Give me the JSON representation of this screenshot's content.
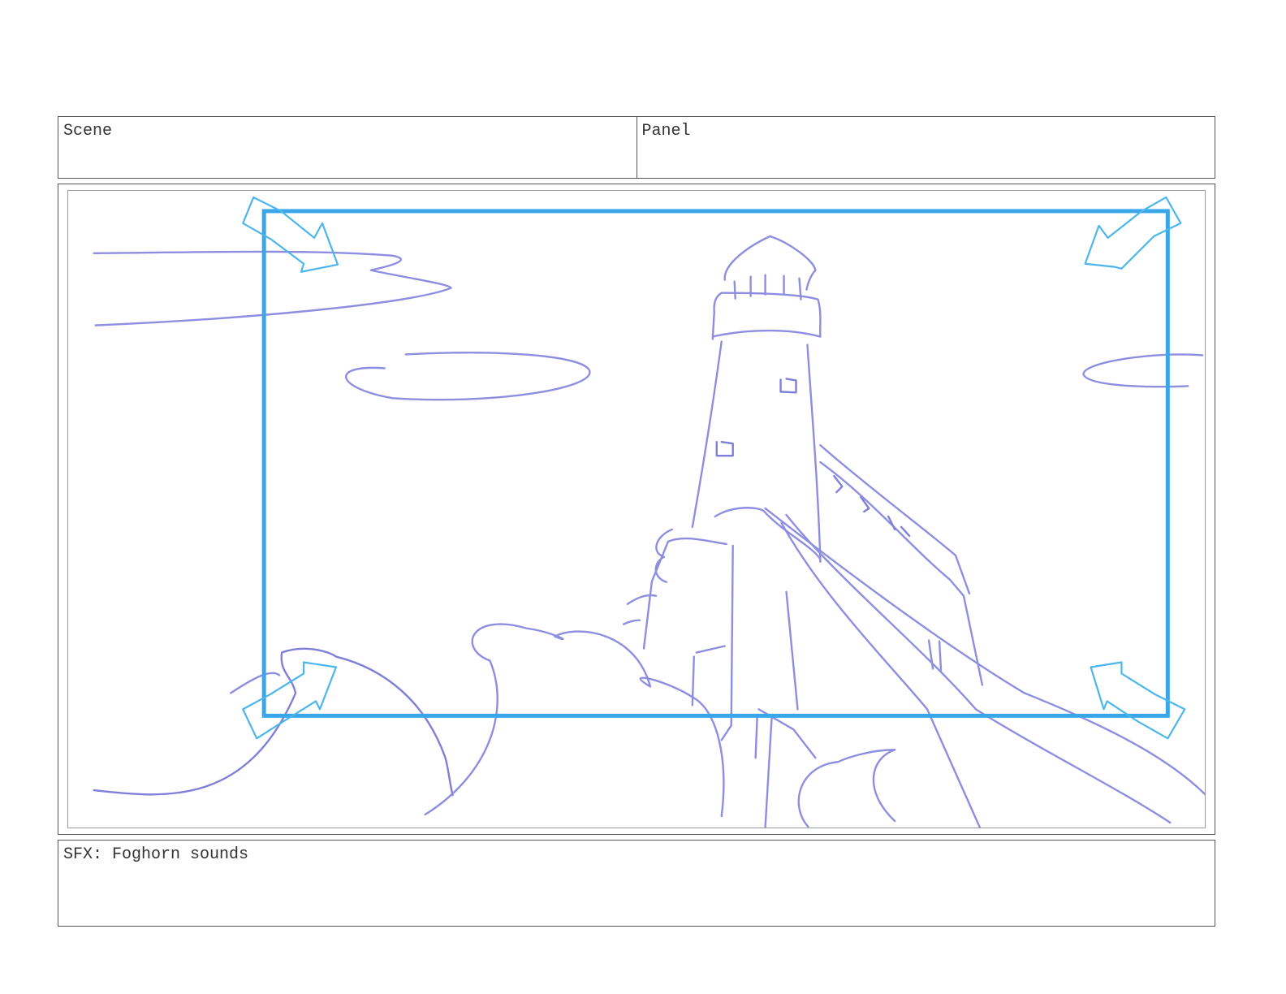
{
  "header": {
    "scene_label": "Scene",
    "panel_label": "Panel"
  },
  "notes": {
    "text": "SFX: Foghorn sounds"
  },
  "colors": {
    "frame_guide": "#3aa6ea",
    "zoom_arrows": "#4cb6ec",
    "sketch": "#8e8ee0",
    "sketch_dark": "#7f7fd8",
    "border": "#555555"
  },
  "sketch": {
    "subject": "lighthouse",
    "icons": [
      "zoom-in-arrow-icon"
    ]
  }
}
